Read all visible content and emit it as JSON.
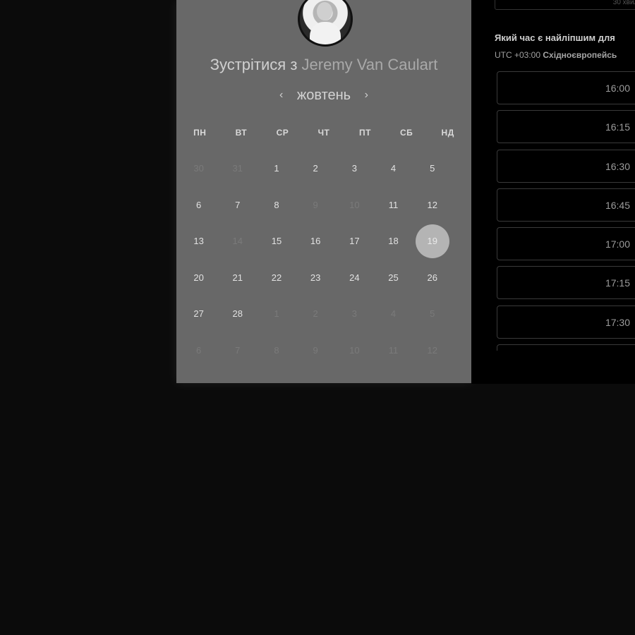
{
  "scheduler": {
    "title_prefix": "Зустрітися з",
    "host_name": "Jeremy Van Caulart",
    "month": "жовтень",
    "prev_arrow": "‹",
    "next_arrow": "›",
    "weekdays": [
      "ПН",
      "ВТ",
      "СР",
      "ЧТ",
      "ПТ",
      "СБ",
      "НД"
    ],
    "weeks": [
      [
        {
          "d": "30",
          "m": true
        },
        {
          "d": "31",
          "m": true
        },
        {
          "d": "1"
        },
        {
          "d": "2"
        },
        {
          "d": "3"
        },
        {
          "d": "4"
        },
        {
          "d": "5"
        }
      ],
      [
        {
          "d": "6"
        },
        {
          "d": "7"
        },
        {
          "d": "8"
        },
        {
          "d": "9",
          "m": true
        },
        {
          "d": "10",
          "m": true
        },
        {
          "d": "11"
        },
        {
          "d": "12"
        }
      ],
      [
        {
          "d": "13"
        },
        {
          "d": "14",
          "m": true
        },
        {
          "d": "15"
        },
        {
          "d": "16"
        },
        {
          "d": "17"
        },
        {
          "d": "18"
        },
        {
          "d": "19",
          "s": true
        }
      ],
      [
        {
          "d": "20"
        },
        {
          "d": "21"
        },
        {
          "d": "22"
        },
        {
          "d": "23"
        },
        {
          "d": "24"
        },
        {
          "d": "25"
        },
        {
          "d": "26"
        }
      ],
      [
        {
          "d": "27"
        },
        {
          "d": "28"
        },
        {
          "d": "1",
          "m": true
        },
        {
          "d": "2",
          "m": true
        },
        {
          "d": "3",
          "m": true
        },
        {
          "d": "4",
          "m": true
        },
        {
          "d": "5",
          "m": true
        }
      ],
      [
        {
          "d": "6",
          "m": true
        },
        {
          "d": "7",
          "m": true
        },
        {
          "d": "8",
          "m": true
        },
        {
          "d": "9",
          "m": true
        },
        {
          "d": "10",
          "m": true
        },
        {
          "d": "11",
          "m": true
        },
        {
          "d": "12",
          "m": true
        }
      ]
    ],
    "selected_day": "19"
  },
  "times": {
    "duration_label": "30 хвили",
    "question": "Який час є найліпшим для",
    "timezone_prefix": "UTC +03:00",
    "timezone_name": "Східноєвропейсь",
    "slots": [
      "16:00",
      "16:15",
      "16:30",
      "16:45",
      "17:00",
      "17:15",
      "17:30",
      ""
    ]
  },
  "colors": {
    "panel_bg": "#686868",
    "selected_circle": "#b4b4b4",
    "page_bg": "#0b0b0b"
  }
}
